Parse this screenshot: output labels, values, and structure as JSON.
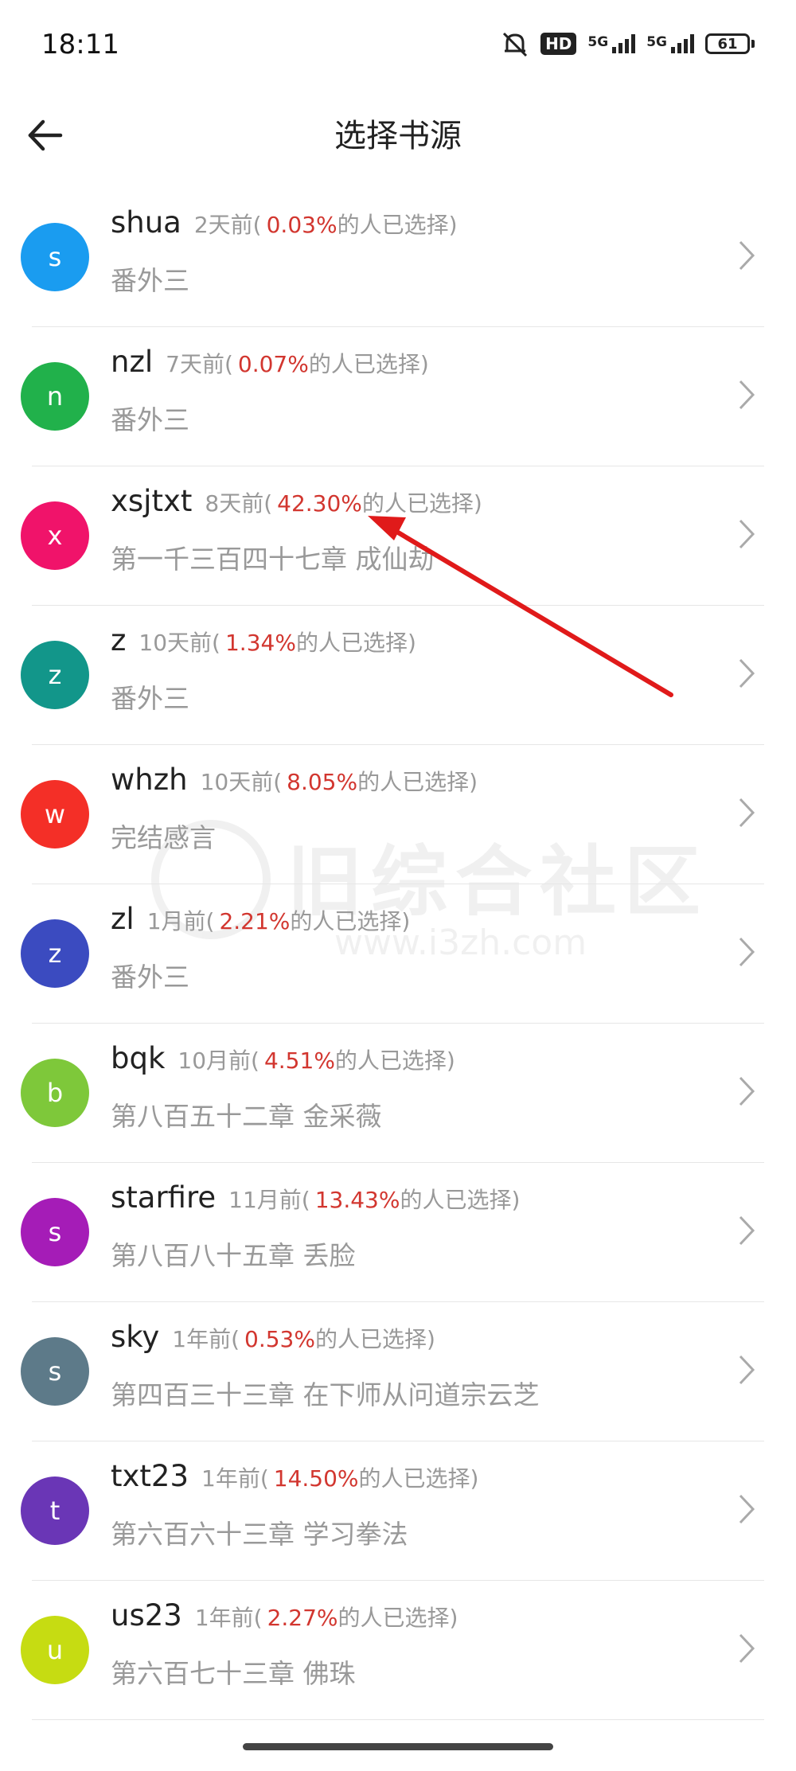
{
  "status_bar": {
    "time": "18:11",
    "hd_badge": "HD",
    "network_1": "5G",
    "network_2": "5G",
    "battery": "61"
  },
  "header": {
    "title": "选择书源",
    "back_icon": "arrow-left-icon"
  },
  "watermark": {
    "text": "旧综合社区",
    "url": "www.i3zh.com"
  },
  "sources": [
    {
      "initial": "s",
      "name": "shua",
      "time": "2天前(",
      "percent": "0.03%",
      "suffix": "的人已选择)",
      "chapter": "番外三",
      "color": "#1a9cf0"
    },
    {
      "initial": "n",
      "name": "nzl",
      "time": "7天前(",
      "percent": "0.07%",
      "suffix": "的人已选择)",
      "chapter": "番外三",
      "color": "#21b14b"
    },
    {
      "initial": "x",
      "name": "xsjtxt",
      "time": "8天前(",
      "percent": "42.30%",
      "suffix": "的人已选择)",
      "chapter": "第一千三百四十七章 成仙劫",
      "color": "#f0136a"
    },
    {
      "initial": "z",
      "name": "z",
      "time": "10天前(",
      "percent": "1.34%",
      "suffix": "的人已选择)",
      "chapter": "番外三",
      "color": "#12968a"
    },
    {
      "initial": "w",
      "name": "whzh",
      "time": "10天前(",
      "percent": "8.05%",
      "suffix": "的人已选择)",
      "chapter": "完结感言",
      "color": "#f42f27"
    },
    {
      "initial": "z",
      "name": "zl",
      "time": "1月前(",
      "percent": "2.21%",
      "suffix": "的人已选择)",
      "chapter": "番外三",
      "color": "#3b4bc0"
    },
    {
      "initial": "b",
      "name": "bqk",
      "time": "10月前(",
      "percent": "4.51%",
      "suffix": "的人已选择)",
      "chapter": "第八百五十二章 金采薇",
      "color": "#7ec83a"
    },
    {
      "initial": "s",
      "name": "starfire",
      "time": "11月前(",
      "percent": "13.43%",
      "suffix": "的人已选择)",
      "chapter": "第八百八十五章 丢脸",
      "color": "#a51cb7"
    },
    {
      "initial": "s",
      "name": "sky",
      "time": "1年前(",
      "percent": "0.53%",
      "suffix": "的人已选择)",
      "chapter": "第四百三十三章 在下师从问道宗云芝",
      "color": "#5d7a89"
    },
    {
      "initial": "t",
      "name": "txt23",
      "time": "1年前(",
      "percent": "14.50%",
      "suffix": "的人已选择)",
      "chapter": "第六百六十三章 学习拳法",
      "color": "#6a36b6"
    },
    {
      "initial": "u",
      "name": "us23",
      "time": "1年前(",
      "percent": "2.27%",
      "suffix": "的人已选择)",
      "chapter": "第六百七十三章 佛珠",
      "color": "#c6dc12"
    }
  ],
  "colors": {
    "percent": "#d2362f",
    "meta_text": "#999999",
    "annotation_arrow": "#e01a1a"
  }
}
